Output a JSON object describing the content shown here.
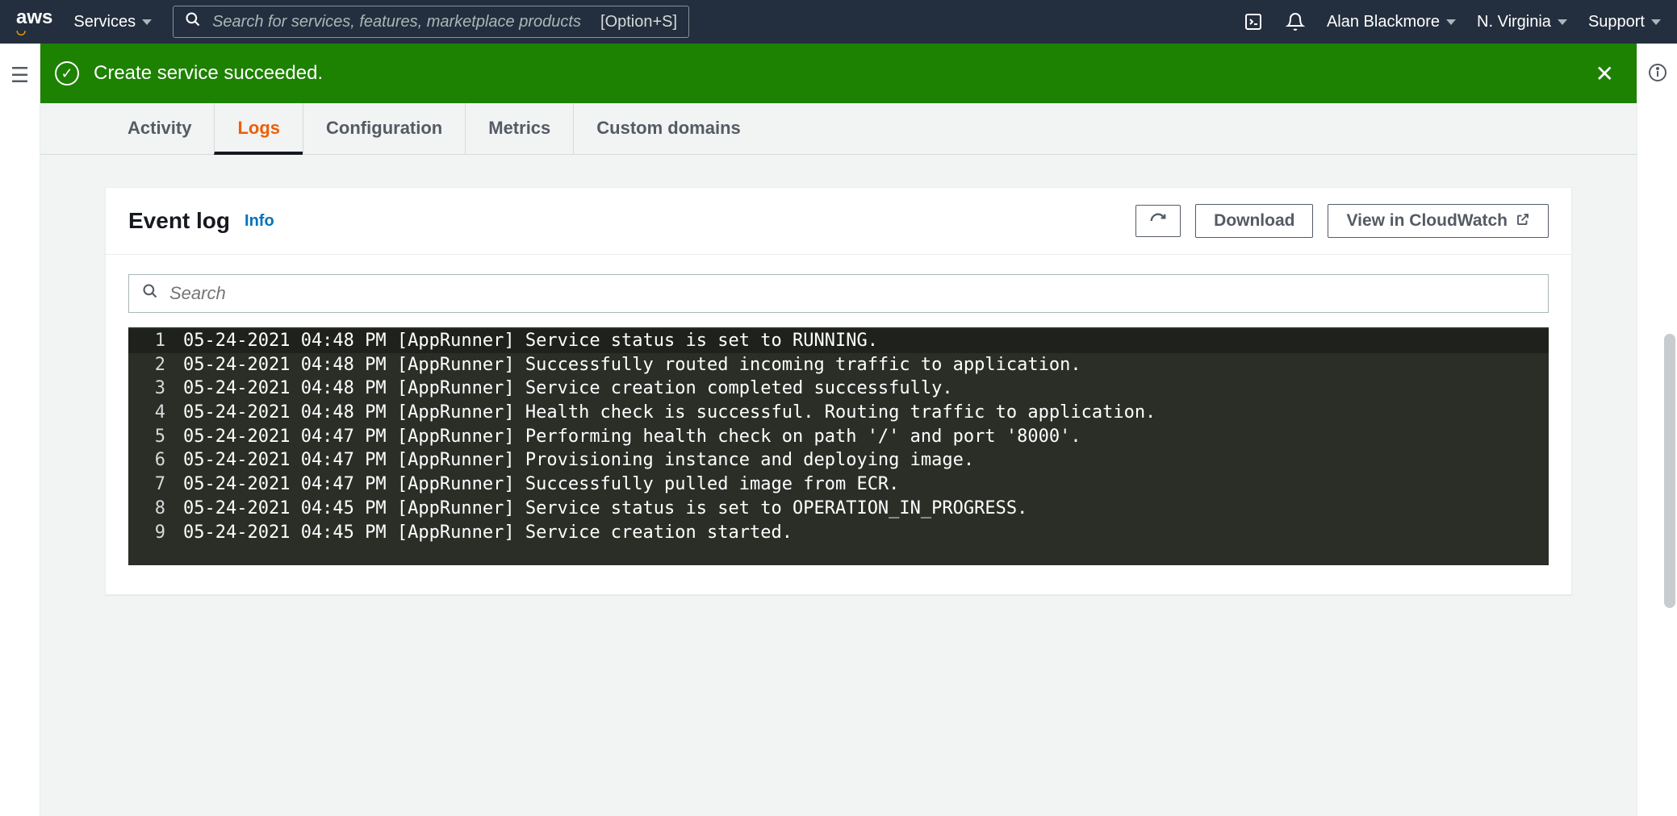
{
  "nav": {
    "services": "Services",
    "search_placeholder": "Search for services, features, marketplace products",
    "search_kbd": "[Option+S]",
    "user": "Alan Blackmore",
    "region": "N. Virginia",
    "support": "Support"
  },
  "flash": {
    "message": "Create service succeeded."
  },
  "tabs": [
    {
      "label": "Activity",
      "active": false
    },
    {
      "label": "Logs",
      "active": true
    },
    {
      "label": "Configuration",
      "active": false
    },
    {
      "label": "Metrics",
      "active": false
    },
    {
      "label": "Custom domains",
      "active": false
    }
  ],
  "panel": {
    "title": "Event log",
    "info": "Info",
    "refresh_aria": "Refresh",
    "download": "Download",
    "cloudwatch": "View in CloudWatch",
    "search_placeholder": "Search"
  },
  "log": [
    "05-24-2021 04:48 PM [AppRunner] Service status is set to RUNNING.",
    "05-24-2021 04:48 PM [AppRunner] Successfully routed incoming traffic to application.",
    "05-24-2021 04:48 PM [AppRunner] Service creation completed successfully.",
    "05-24-2021 04:48 PM [AppRunner] Health check is successful. Routing traffic to application.",
    "05-24-2021 04:47 PM [AppRunner] Performing health check on path '/' and port '8000'.",
    "05-24-2021 04:47 PM [AppRunner] Provisioning instance and deploying image.",
    "05-24-2021 04:47 PM [AppRunner] Successfully pulled image from ECR.",
    "05-24-2021 04:45 PM [AppRunner] Service status is set to OPERATION_IN_PROGRESS.",
    "05-24-2021 04:45 PM [AppRunner] Service creation started."
  ]
}
